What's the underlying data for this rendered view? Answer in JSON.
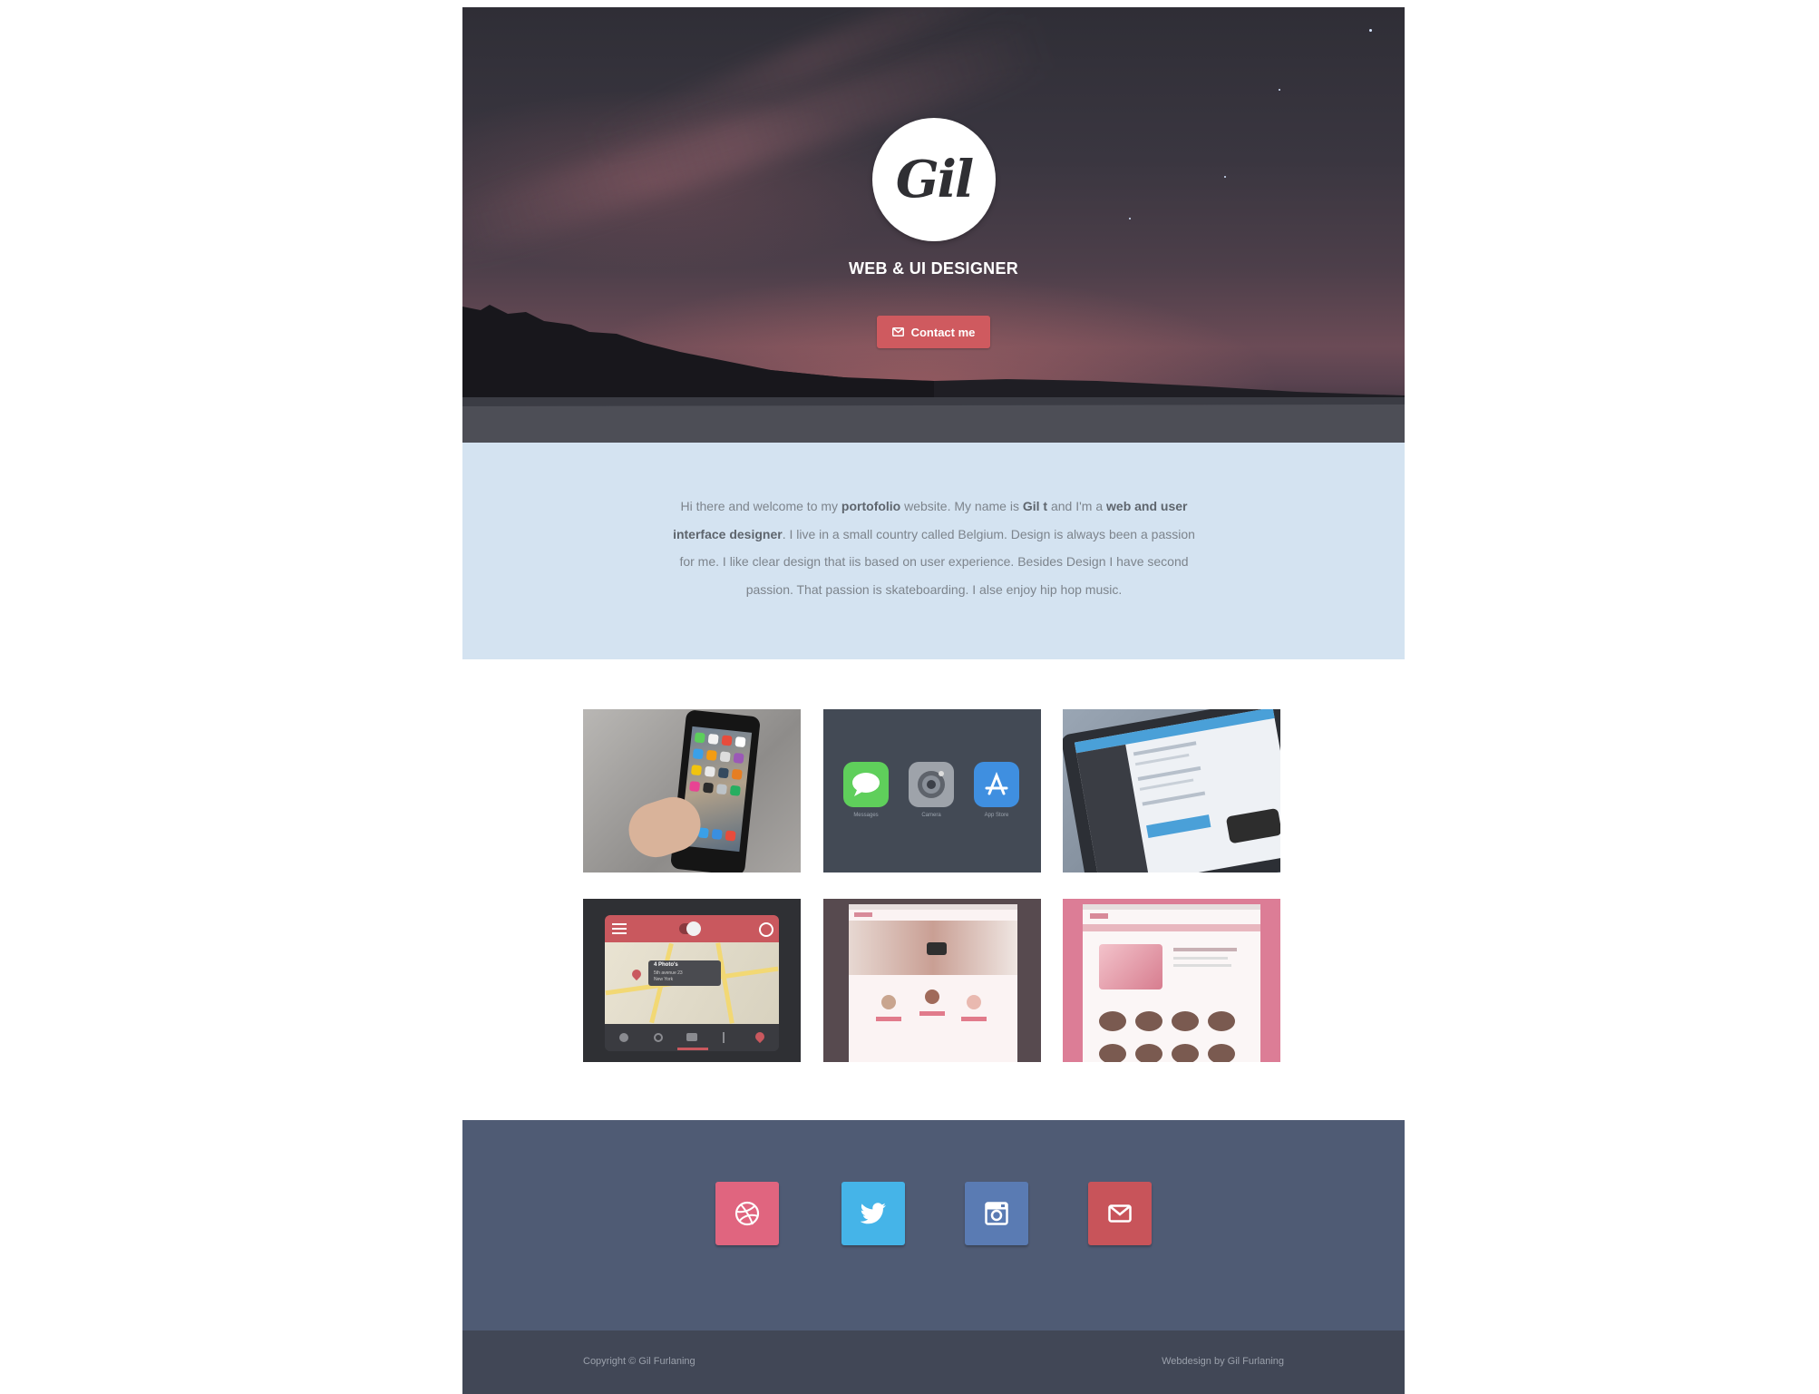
{
  "hero": {
    "logo_text": "Gil",
    "role": "WEB & UI DESIGNER",
    "contact_label": "Contact me"
  },
  "about": {
    "parts": [
      "Hi there and welcome to my ",
      "portofolio",
      " website. My name is ",
      "Gil t",
      " and I'm a ",
      "web and user interface designer",
      ". I live in a small country called Belgium. Design is always been a passion for me. I like clear design that iis based on user experience. Besides Design I have second passion. That passion is skateboarding. I alse enjoy hip hop music."
    ]
  },
  "portfolio": {
    "items": [
      {
        "name": "iphone-app-shot"
      },
      {
        "name": "ios-icons-shot",
        "icons": [
          "Messages",
          "Camera",
          "App Store"
        ]
      },
      {
        "name": "tablet-mail-app-shot"
      },
      {
        "name": "map-app-shot",
        "badge": "4 Photo's",
        "subtitle": "5th avenue 23",
        "city": "New York"
      },
      {
        "name": "pink-website-shot"
      },
      {
        "name": "cupcake-website-shot"
      }
    ]
  },
  "social": {
    "links": [
      {
        "icon": "dribbble-icon",
        "color": "#e0657f"
      },
      {
        "icon": "twitter-icon",
        "color": "#45b4e8"
      },
      {
        "icon": "instagram-icon",
        "color": "#5a7bb3"
      },
      {
        "icon": "mail-icon",
        "color": "#c8545a"
      }
    ]
  },
  "footer": {
    "copyright": "Copyright © Gil Furlaning",
    "credit": "Webdesign by Gil Furlaning"
  },
  "colors": {
    "accent": "#cf5a5f",
    "about_bg": "#d4e3f1",
    "social_bg": "#4f5b74",
    "footer_bg": "#414756"
  }
}
